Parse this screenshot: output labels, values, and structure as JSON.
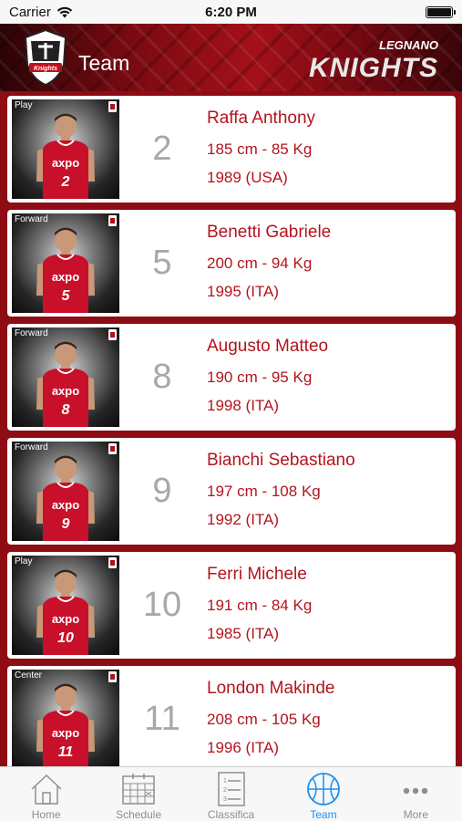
{
  "status": {
    "carrier": "Carrier",
    "time": "6:20 PM"
  },
  "header": {
    "title": "Team",
    "brand_top": "LEGNANO",
    "brand_main": "KNIGHTS",
    "logo_text": "Knights"
  },
  "players": [
    {
      "role": "Play",
      "number": "2",
      "name": "Raffa Anthony",
      "stats": "185 cm - 85 Kg",
      "origin": "1989 (USA)",
      "jersey": "2"
    },
    {
      "role": "Forward",
      "number": "5",
      "name": "Benetti Gabriele",
      "stats": "200 cm - 94 Kg",
      "origin": "1995 (ITA)",
      "jersey": "5"
    },
    {
      "role": "Forward",
      "number": "8",
      "name": "Augusto Matteo",
      "stats": "190 cm - 95 Kg",
      "origin": "1998 (ITA)",
      "jersey": "8"
    },
    {
      "role": "Forward",
      "number": "9",
      "name": "Bianchi Sebastiano",
      "stats": "197 cm - 108 Kg",
      "origin": "1992 (ITA)",
      "jersey": "9"
    },
    {
      "role": "Play",
      "number": "10",
      "name": "Ferri Michele",
      "stats": "191 cm - 84 Kg",
      "origin": "1985 (ITA)",
      "jersey": "10"
    },
    {
      "role": "Center",
      "number": "11",
      "name": "London Makinde",
      "stats": "208 cm - 105 Kg",
      "origin": "1996 (ITA)",
      "jersey": "11"
    }
  ],
  "jersey_sponsor": "axpo",
  "tabs": [
    {
      "label": "Home",
      "icon": "home-icon",
      "active": false
    },
    {
      "label": "Schedule",
      "icon": "calendar-icon",
      "active": false
    },
    {
      "label": "Classifica",
      "icon": "list-icon",
      "active": false
    },
    {
      "label": "Team",
      "icon": "basketball-icon",
      "active": true
    },
    {
      "label": "More",
      "icon": "more-icon",
      "active": false
    }
  ],
  "colors": {
    "accent": "#b3141e",
    "header_red": "#8e0c14",
    "tab_active": "#1a8ff0",
    "tab_inactive": "#8e8e8e"
  }
}
